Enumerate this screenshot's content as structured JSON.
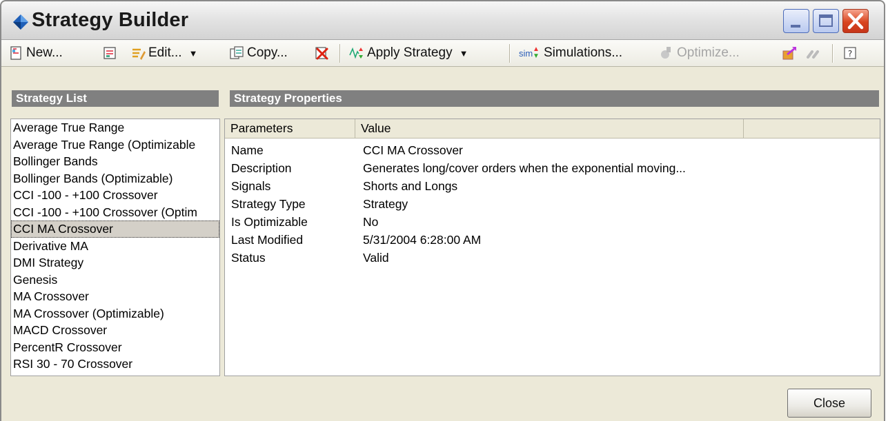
{
  "window": {
    "title": "Strategy Builder"
  },
  "toolbar": {
    "new_label": "New...",
    "edit_label": "Edit...",
    "copy_label": "Copy...",
    "apply_label": "Apply Strategy",
    "simulations_label": "Simulations...",
    "optimize_label": "Optimize...",
    "icons": {
      "new": "new-document-icon",
      "edit": "edit-icon",
      "copy": "copy-icon",
      "delete": "delete-icon",
      "apply": "apply-strategy-icon",
      "simulations": "simulations-icon",
      "optimize": "optimize-icon",
      "export": "export-icon",
      "help": "help-icon"
    },
    "simulations_icon_text": "sim"
  },
  "strategy_list": {
    "header": "Strategy List",
    "items": [
      "Average True Range",
      "Average True Range (Optimizable",
      "Bollinger Bands",
      "Bollinger Bands (Optimizable)",
      "CCI -100 - +100 Crossover",
      "CCI -100 - +100 Crossover (Optim",
      "CCI MA Crossover",
      "Derivative MA",
      "DMI Strategy",
      "Genesis",
      "MA Crossover",
      "MA Crossover (Optimizable)",
      "MACD Crossover",
      "PercentR Crossover",
      "RSI 30 - 70 Crossover"
    ],
    "selected": "CCI MA Crossover"
  },
  "properties": {
    "header": "Strategy Properties",
    "columns": [
      "Parameters",
      "Value"
    ],
    "rows": [
      {
        "param": "Name",
        "value": "CCI MA Crossover"
      },
      {
        "param": "Description",
        "value": "Generates long/cover orders when the exponential moving..."
      },
      {
        "param": "Signals",
        "value": "Shorts and Longs"
      },
      {
        "param": "Strategy Type",
        "value": "Strategy"
      },
      {
        "param": "Is Optimizable",
        "value": "No"
      },
      {
        "param": "Last Modified",
        "value": "5/31/2004 6:28:00 AM"
      },
      {
        "param": "Status",
        "value": "Valid"
      }
    ]
  },
  "footer": {
    "close_label": "Close"
  },
  "colors": {
    "panel_header": "#808080",
    "window_bg": "#ece9d8",
    "close_red": "#d9451f"
  }
}
